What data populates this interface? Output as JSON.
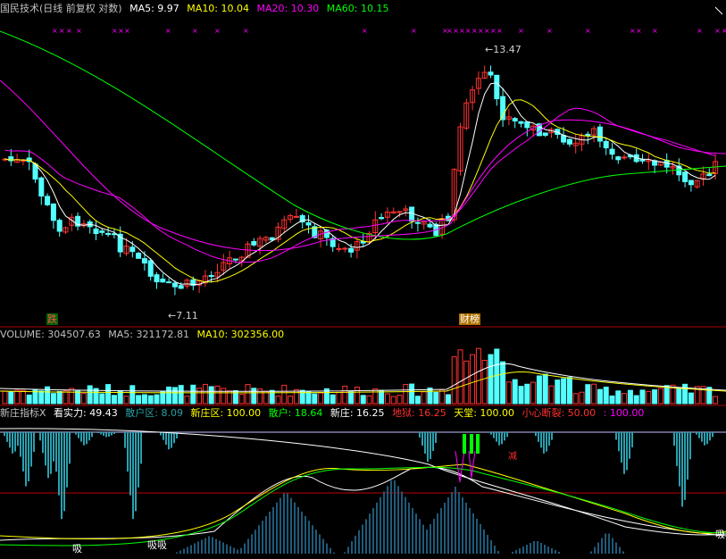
{
  "main_header": {
    "title": "国民技术(日线 前复权 对数)",
    "ma5": "MA5: 9.97",
    "ma10": "MA10: 10.04",
    "ma20": "MA20: 10.30",
    "ma60": "MA60: 10.15"
  },
  "volume_header": {
    "volume": "VOLUME: 304507.63",
    "ma5": "MA5: 321172.81",
    "ma10": "MA10: 302356.00"
  },
  "indicator_header": {
    "name": "新庄指标X",
    "kanshili": "看实力: 49.43",
    "sanhuqu": "散户区: 8.09",
    "xinzhuangqu": "新庄区: 100.00",
    "sanhu": "散户: 18.64",
    "xinzhuang": "新庄: 16.25",
    "diyu": "地狱: 16.25",
    "tiantang": "天堂: 100.00",
    "xiaoxin": "小心断裂: 50.00",
    "last": ": 100.00"
  },
  "annotations": {
    "high": "13.47",
    "low": "7.11",
    "die": "跌",
    "bang": "财榜",
    "xi": "吸吸",
    "xi2": "吸",
    "xi3": "吸",
    "jian": "减"
  },
  "colors": {
    "up": "#ff3232",
    "down": "#54ffff",
    "ma5": "#ffffff",
    "ma10": "#ffff00",
    "ma20": "#ff00ff",
    "ma60": "#00ff00",
    "separator": "#aa0000"
  }
}
